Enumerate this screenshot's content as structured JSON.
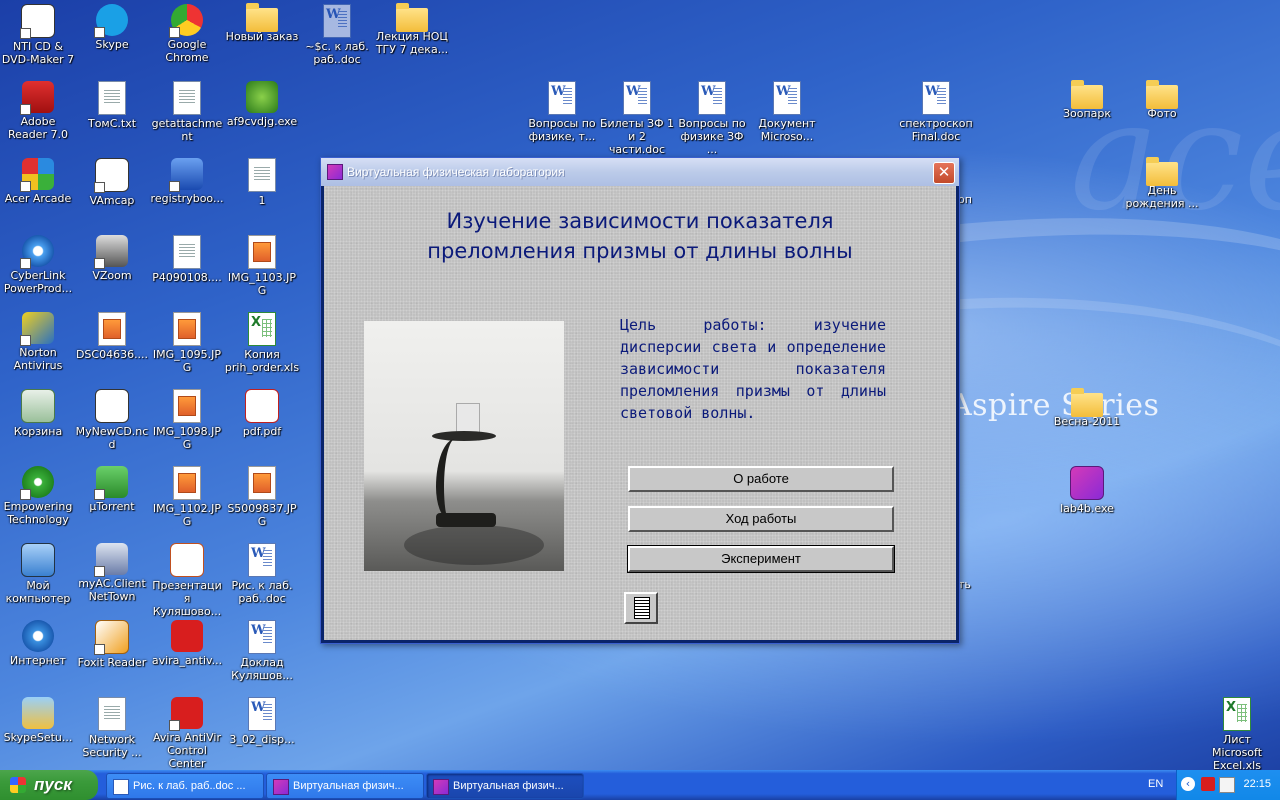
{
  "desktop": {
    "icons": [
      {
        "label": "NTI CD & DVD-Maker 7"
      },
      {
        "label": "Skype"
      },
      {
        "label": "Google Chrome"
      },
      {
        "label": "Новый заказ"
      },
      {
        "label": "~$с. к лаб. раб..doc"
      },
      {
        "label": "Лекция НОЦ ТГУ 7 дека..."
      },
      {
        "label": "Adobe Reader 7.0"
      },
      {
        "label": "ТомС.txt"
      },
      {
        "label": "getattachment"
      },
      {
        "label": "af9cvdjg.exe"
      },
      {
        "label": "Acer Arcade"
      },
      {
        "label": "VAmcap"
      },
      {
        "label": "registryboo..."
      },
      {
        "label": "1"
      },
      {
        "label": "CyberLink PowerProd..."
      },
      {
        "label": "VZoom"
      },
      {
        "label": "P4090108...."
      },
      {
        "label": "IMG_1103.JPG"
      },
      {
        "label": "Norton Antivirus"
      },
      {
        "label": "DSC04636...."
      },
      {
        "label": "IMG_1095.JPG"
      },
      {
        "label": "Копия prih_order.xls"
      },
      {
        "label": "Корзина"
      },
      {
        "label": "MyNewCD.ncd"
      },
      {
        "label": "IMG_1098.JPG"
      },
      {
        "label": "pdf.pdf"
      },
      {
        "label": "Empowering Technology"
      },
      {
        "label": "µTorrent"
      },
      {
        "label": "IMG_1102.JPG"
      },
      {
        "label": "S5009837.JPG"
      },
      {
        "label": "Мой компьютер"
      },
      {
        "label": "myAC.Client NetTown"
      },
      {
        "label": "Презентация Куляшово..."
      },
      {
        "label": "Рис. к лаб. раб..doc"
      },
      {
        "label": "Интернет"
      },
      {
        "label": "Foxit Reader"
      },
      {
        "label": "avira_antiv..."
      },
      {
        "label": "Доклад Куляшов..."
      },
      {
        "label": "SkypeSetu..."
      },
      {
        "label": "Network Security ..."
      },
      {
        "label": "Avira AntiVir Control Center"
      },
      {
        "label": "3_02_disp..."
      },
      {
        "label": "Вопросы по физике, т..."
      },
      {
        "label": "Билеты ЗФ 1 и 2 части.doc"
      },
      {
        "label": "Вопросы по физике ЗФ ..."
      },
      {
        "label": "Документ Microsо..."
      },
      {
        "label": "спектроскоп Final.doc"
      },
      {
        "label": "Зоопарк"
      },
      {
        "label": "Фото"
      },
      {
        "label": "День рождения ..."
      },
      {
        "label": "Весна-2011"
      },
      {
        "label": "lab4b.exe"
      },
      {
        "label": "Лист Microsoft Excel.xls"
      }
    ],
    "wallpaper_text": "Aspire Series",
    "wallpaper_logo": "acer",
    "fragments": {
      "opx": "оп",
      "tch": "ть"
    }
  },
  "window": {
    "title": "Виртуальная физическая лаборатория",
    "close_glyph": "✕",
    "heading_line1": "Изучение зависимости показателя",
    "heading_line2": "преломления призмы от длины волны",
    "goal_text": "Цель работы: изучение дисперсии света и определение зависимости показателя преломления призмы от длины световой волны.",
    "buttons": {
      "about": "О работе",
      "procedure": "Ход работы",
      "experiment": "Эксперимент"
    }
  },
  "taskbar": {
    "start_label": "пуск",
    "tasks": [
      {
        "label": "Рис. к лаб. раб..doc ...",
        "icon": "word-icon"
      },
      {
        "label": "Виртуальная физич...",
        "icon": "lab-icon"
      },
      {
        "label": "Виртуальная физич...",
        "icon": "lab-icon"
      }
    ],
    "language": "EN",
    "tray_chevron": "‹",
    "clock": "22:15"
  }
}
